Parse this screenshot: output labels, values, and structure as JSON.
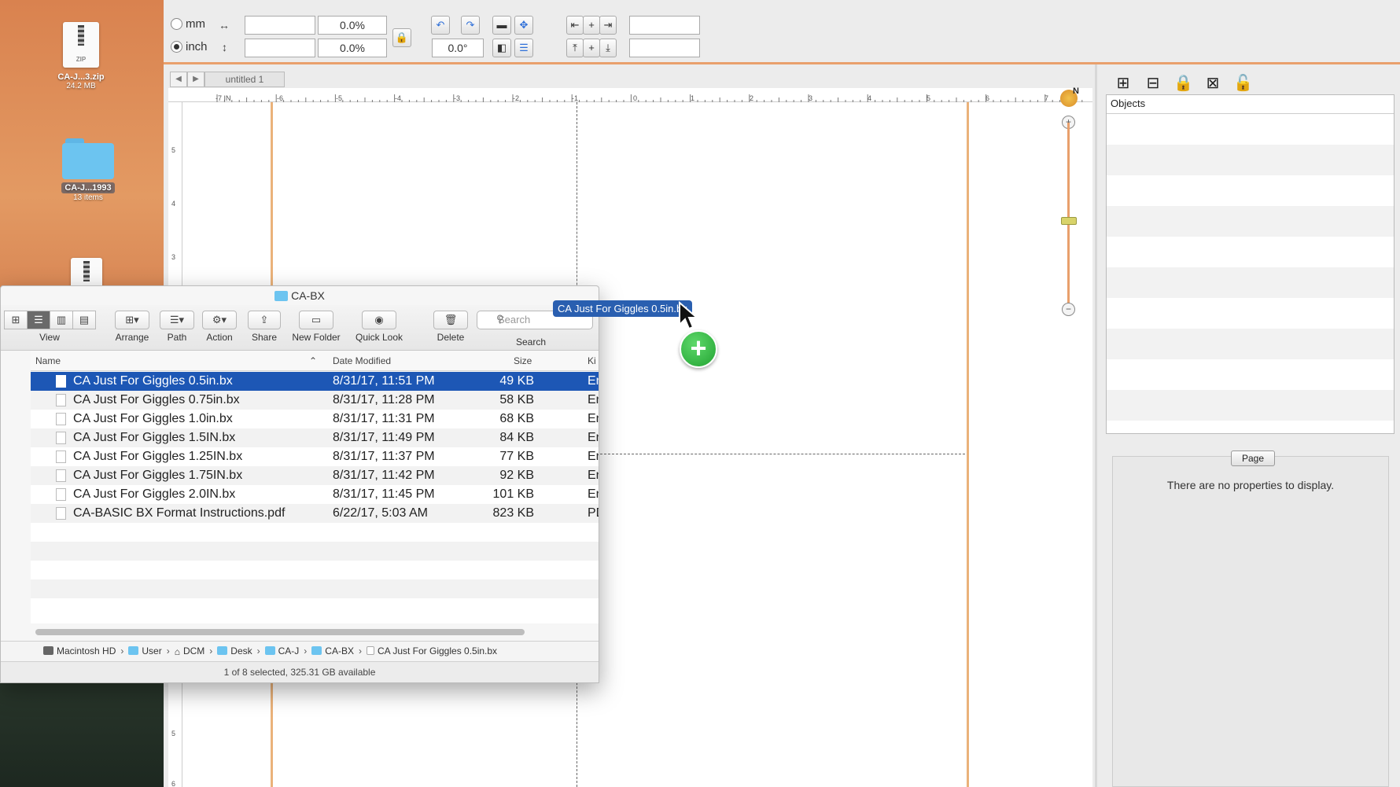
{
  "desktop": {
    "items": [
      {
        "name": "CA-J...3.zip",
        "sub": "24.2 MB",
        "zip_label": "ZIP"
      },
      {
        "name": "CA-J...1993",
        "sub": "13 items"
      }
    ]
  },
  "toolbar": {
    "unit_mm": "mm",
    "unit_inch": "inch",
    "selected_unit": "inch",
    "width_value": "",
    "height_value": "",
    "width_pct": "0.0%",
    "height_pct": "0.0%",
    "rotation": "0.0°",
    "field_right_1": "",
    "field_right_2": ""
  },
  "document": {
    "tab_title": "untitled 1",
    "ruler_numbers": [
      "-7 IN",
      "-6",
      "-5",
      "-4",
      "-3",
      "-2",
      "-1",
      "0",
      "1",
      "2",
      "3",
      "4",
      "5",
      "6",
      "7"
    ],
    "vruler_numbers": [
      "5",
      "4",
      "3",
      "5",
      "6"
    ],
    "compass_letter": "N"
  },
  "panel": {
    "objects_header": "Objects",
    "page_button": "Page",
    "no_properties": "There are no properties to display."
  },
  "finder": {
    "title": "CA-BX",
    "toolbar_labels": {
      "view": "View",
      "arrange": "Arrange",
      "path": "Path",
      "action": "Action",
      "share": "Share",
      "new_folder": "New Folder",
      "quick_look": "Quick Look",
      "delete": "Delete",
      "search": "Search"
    },
    "search_placeholder": "Search",
    "columns": {
      "name": "Name",
      "date": "Date Modified",
      "size": "Size",
      "kind": "Ki"
    },
    "files": [
      {
        "name": "CA Just For Giggles 0.5in.bx",
        "date": "8/31/17, 11:51 PM",
        "size": "49 KB",
        "kind": "En"
      },
      {
        "name": "CA Just For Giggles 0.75in.bx",
        "date": "8/31/17, 11:28 PM",
        "size": "58 KB",
        "kind": "En"
      },
      {
        "name": "CA Just For Giggles 1.0in.bx",
        "date": "8/31/17, 11:31 PM",
        "size": "68 KB",
        "kind": "En"
      },
      {
        "name": "CA Just For Giggles 1.5IN.bx",
        "date": "8/31/17, 11:49 PM",
        "size": "84 KB",
        "kind": "En"
      },
      {
        "name": "CA Just For Giggles 1.25IN.bx",
        "date": "8/31/17, 11:37 PM",
        "size": "77 KB",
        "kind": "En"
      },
      {
        "name": "CA Just For Giggles 1.75IN.bx",
        "date": "8/31/17, 11:42 PM",
        "size": "92 KB",
        "kind": "En"
      },
      {
        "name": "CA Just For Giggles 2.0IN.bx",
        "date": "8/31/17, 11:45 PM",
        "size": "101 KB",
        "kind": "En"
      },
      {
        "name": "CA-BASIC BX Format Instructions.pdf",
        "date": "6/22/17, 5:03 AM",
        "size": "823 KB",
        "kind": "PD"
      }
    ],
    "path": [
      "Macintosh HD",
      "User",
      "DCM",
      "Desk",
      "CA-J",
      "CA-BX",
      "CA Just For Giggles 0.5in.bx"
    ],
    "status": "1 of 8 selected, 325.31 GB available"
  },
  "drag": {
    "label": "CA Just For Giggles 0.5in.bx",
    "badge": "+"
  },
  "colors": {
    "accent_orange": "#e9a06c",
    "selection_blue": "#1d57b5",
    "plus_green": "#22a332"
  }
}
